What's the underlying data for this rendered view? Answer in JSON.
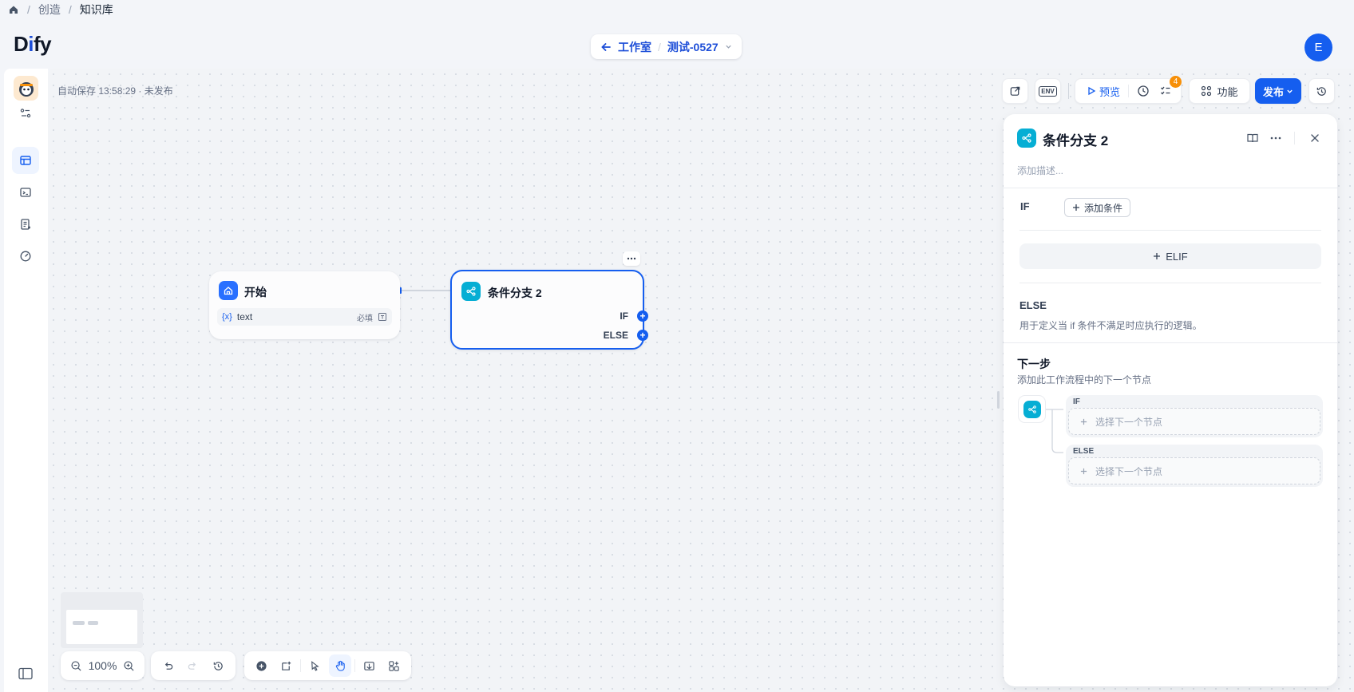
{
  "breadcrumb": {
    "items": [
      "创造",
      "知识库"
    ]
  },
  "header": {
    "logo": "Dify",
    "nav_back_label": "工作室",
    "app_name": "测试-0527",
    "avatar_initial": "E"
  },
  "canvas": {
    "autosave_text": "自动保存 13:58:29 · 未发布"
  },
  "toolbar": {
    "preview_label": "预览",
    "checklist_count": "4",
    "features_label": "功能",
    "publish_label": "发布",
    "env_label": "ENV"
  },
  "nodes": {
    "start": {
      "title": "开始",
      "var_symbol": "{x}",
      "var_name": "text",
      "required_label": "必填"
    },
    "ifelse": {
      "title": "条件分支 2",
      "if_label": "IF",
      "else_label": "ELSE"
    }
  },
  "panel": {
    "title": "条件分支 2",
    "description_placeholder": "添加描述...",
    "if_label": "IF",
    "add_condition_label": "添加条件",
    "elif_label": "ELIF",
    "else_title": "ELSE",
    "else_desc": "用于定义当 if 条件不满足时应执行的逻辑。",
    "next_step_title": "下一步",
    "next_step_desc": "添加此工作流程中的下一个节点",
    "branches": [
      {
        "label": "IF",
        "select_label": "选择下一个节点"
      },
      {
        "label": "ELSE",
        "select_label": "选择下一个节点"
      }
    ]
  },
  "bottom": {
    "zoom_level": "100%"
  },
  "colors": {
    "accent": "#155eef",
    "ifelse_node": "#06aed4",
    "start_node": "#2970ff",
    "badge": "#f79009"
  }
}
